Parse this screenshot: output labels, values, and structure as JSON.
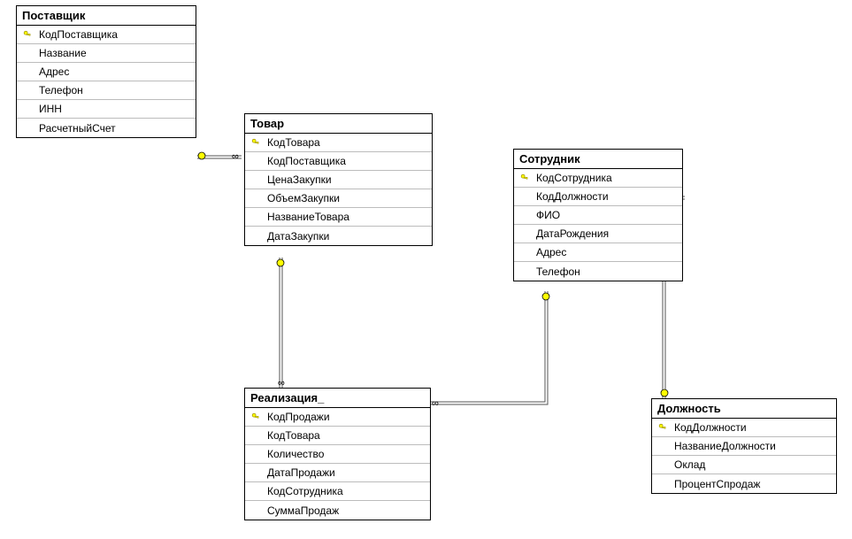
{
  "tables": {
    "supplier": {
      "title": "Поставщик",
      "fields": [
        {
          "name": "КодПоставщика",
          "pk": true
        },
        {
          "name": "Название",
          "pk": false
        },
        {
          "name": "Адрес",
          "pk": false
        },
        {
          "name": "Телефон",
          "pk": false
        },
        {
          "name": "ИНН",
          "pk": false
        },
        {
          "name": "РасчетныйСчет",
          "pk": false
        }
      ]
    },
    "product": {
      "title": "Товар",
      "fields": [
        {
          "name": "КодТовара",
          "pk": true
        },
        {
          "name": "КодПоставщика",
          "pk": false
        },
        {
          "name": "ЦенаЗакупки",
          "pk": false
        },
        {
          "name": "ОбъемЗакупки",
          "pk": false
        },
        {
          "name": "НазваниеТовара",
          "pk": false
        },
        {
          "name": "ДатаЗакупки",
          "pk": false
        }
      ]
    },
    "employee": {
      "title": "Сотрудник",
      "fields": [
        {
          "name": "КодСотрудника",
          "pk": true
        },
        {
          "name": "КодДолжности",
          "pk": false
        },
        {
          "name": "ФИО",
          "pk": false
        },
        {
          "name": "ДатаРождения",
          "pk": false
        },
        {
          "name": "Адрес",
          "pk": false
        },
        {
          "name": "Телефон",
          "pk": false
        }
      ]
    },
    "sale": {
      "title": "Реализация_",
      "fields": [
        {
          "name": "КодПродажи",
          "pk": true
        },
        {
          "name": "КодТовара",
          "pk": false
        },
        {
          "name": "Количество",
          "pk": false
        },
        {
          "name": "ДатаПродажи",
          "pk": false
        },
        {
          "name": "КодСотрудника",
          "pk": false
        },
        {
          "name": "СуммаПродаж",
          "pk": false
        }
      ]
    },
    "position": {
      "title": "Должность",
      "fields": [
        {
          "name": "КодДолжности",
          "pk": true
        },
        {
          "name": "НазваниеДолжности",
          "pk": false
        },
        {
          "name": "Оклад",
          "pk": false
        },
        {
          "name": "ПроцентСпродаж",
          "pk": false
        }
      ]
    }
  },
  "relations": [
    {
      "from": "supplier",
      "to": "product",
      "type": "one-to-many"
    },
    {
      "from": "product",
      "to": "sale",
      "type": "one-to-many"
    },
    {
      "from": "employee",
      "to": "sale",
      "type": "one-to-many"
    },
    {
      "from": "position",
      "to": "employee",
      "type": "one-to-many"
    }
  ]
}
